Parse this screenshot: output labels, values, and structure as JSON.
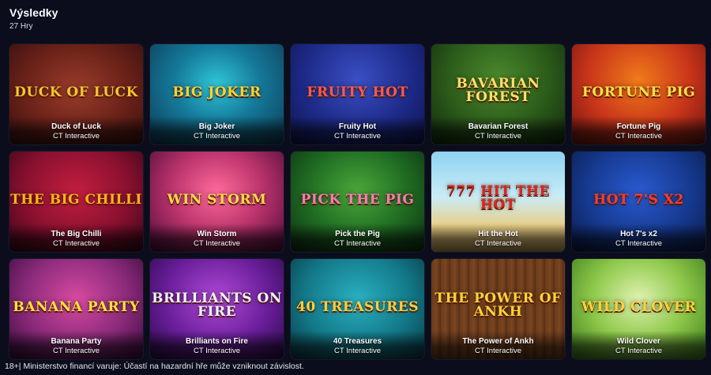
{
  "header": {
    "title": "Výsledky",
    "count": "27 Hry"
  },
  "games": [
    {
      "name": "Duck of Luck",
      "provider": "CT Interactive",
      "logo": "DUCK OF LUCK",
      "bg": "radial-gradient(ellipse at 50% 45%, #9a3c2c 0%, #6b2218 55%, #3a1010 100%)",
      "logo_color": "#f6c531"
    },
    {
      "name": "Big Joker",
      "provider": "CT Interactive",
      "logo": "BIG JOKER",
      "bg": "radial-gradient(ellipse at 50% 40%, #2fc6d8 0%, #157a9a 45%, #0c3a55 100%)",
      "logo_color": "#ffd233"
    },
    {
      "name": "Fruity Hot",
      "provider": "CT Interactive",
      "logo": "FRUITY HOT",
      "bg": "radial-gradient(ellipse at 50% 35%, #3a4fc4 0%, #1e2b8a 55%, #0e1550 100%)",
      "logo_color": "#ff5a4a"
    },
    {
      "name": "Bavarian Forest",
      "provider": "CT Interactive",
      "logo": "Bavarian Forest",
      "bg": "radial-gradient(ellipse at 50% 35%, #4a8a2c 0%, #2b5a1a 55%, #132a0c 100%)",
      "logo_color": "#ffdf6a"
    },
    {
      "name": "Fortune Pig",
      "provider": "CT Interactive",
      "logo": "FORTUNE PIG",
      "bg": "radial-gradient(ellipse at 50% 35%, #f07a1a 0%, #c8341a 55%, #6a1410 100%)",
      "logo_color": "#ffe04a"
    },
    {
      "name": "The Big Chilli",
      "provider": "CT Interactive",
      "logo": "THE BIG CHILLI",
      "bg": "radial-gradient(ellipse at 50% 40%, #c21e3e 0%, #8a1030 55%, #3a0618 100%)",
      "logo_color": "#ffb21a"
    },
    {
      "name": "Win Storm",
      "provider": "CT Interactive",
      "logo": "WIN STORM",
      "bg": "radial-gradient(ellipse at 50% 40%, #ff6a9a 0%, #b8326a 50%, #4a0a3a 100%)",
      "logo_color": "#ffd84a"
    },
    {
      "name": "Pick the Pig",
      "provider": "CT Interactive",
      "logo": "PICK THE PIG",
      "bg": "radial-gradient(ellipse at 50% 40%, #4aa83a 0%, #1f6a22 55%, #0c3010 100%)",
      "logo_color": "#ff7ab2"
    },
    {
      "name": "Hit the Hot",
      "provider": "CT Interactive",
      "logo": "777 HIT THE HOT",
      "bg": "linear-gradient(to bottom, #8fd3f2 0%, #c9ecf6 45%, #e8cf86 75%, #c9a45a 100%)",
      "logo_color": "#e0241a"
    },
    {
      "name": "Hot 7's x2",
      "provider": "CT Interactive",
      "logo": "HOT 7's x2",
      "bg": "radial-gradient(ellipse at 50% 40%, #2a5ad0 0%, #163a90 55%, #0a1a4a 100%)",
      "logo_color": "#ff3a2a"
    },
    {
      "name": "Banana Party",
      "provider": "CT Interactive",
      "logo": "BANANA PARTY",
      "bg": "radial-gradient(ellipse at 50% 40%, #d84aa0 0%, #8a2a7a 55%, #3a0a3a 100%)",
      "logo_color": "#ffe23a"
    },
    {
      "name": "Brilliants on Fire",
      "provider": "CT Interactive",
      "logo": "BRILLIANTS ON FIRE",
      "bg": "radial-gradient(ellipse at 50% 40%, #b04ad8 0%, #6a1e9a 55%, #2a0a4a 100%)",
      "logo_color": "#f2f2ff"
    },
    {
      "name": "40 Treasures",
      "provider": "CT Interactive",
      "logo": "40 TREASURES",
      "bg": "radial-gradient(ellipse at 50% 40%, #2ab0c0 0%, #137a8a 55%, #083a44 100%)",
      "logo_color": "#ffcf3a"
    },
    {
      "name": "The Power of Ankh",
      "provider": "CT Interactive",
      "logo": "THE POWER OF ANKH",
      "bg": "repeating-linear-gradient(90deg, #6a3a1a 0px, #7a4622 6px, #5a2e14 12px)",
      "logo_color": "#ffd23a"
    },
    {
      "name": "Wild Clover",
      "provider": "CT Interactive",
      "logo": "WILD CLOVER",
      "bg": "radial-gradient(ellipse at 50% 40%, #dff2b0 0%, #8ec84a 50%, #3a7a1a 100%)",
      "logo_color": "#ffd23a"
    }
  ],
  "footer": {
    "text": "18+| Ministerstvo financí varuje: Účastí na hazardní hře může vzniknout závislost."
  }
}
